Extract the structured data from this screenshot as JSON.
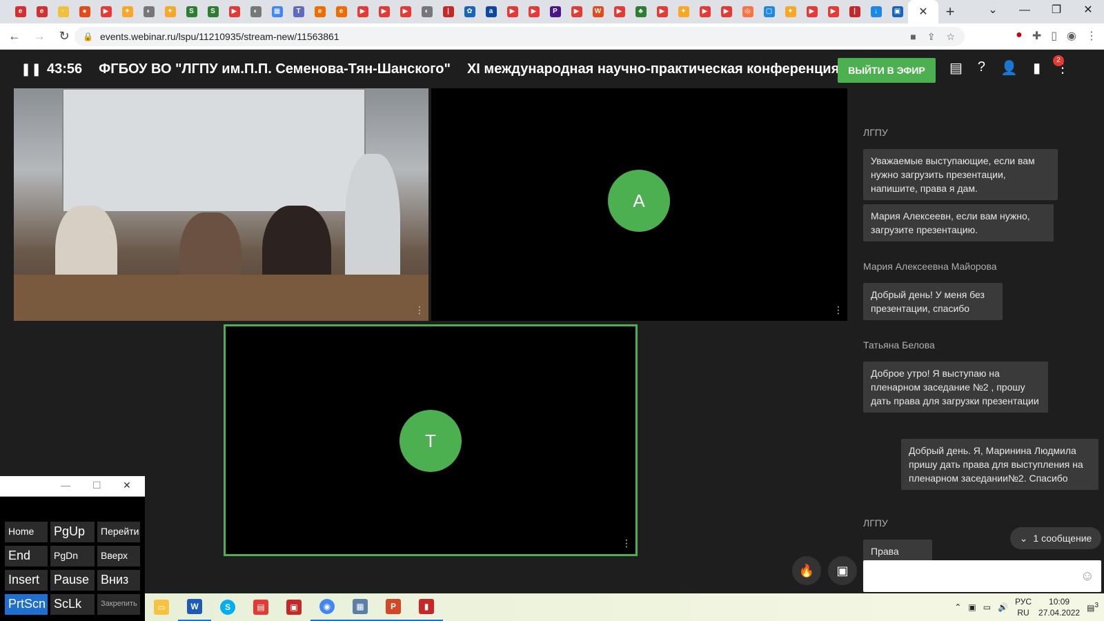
{
  "browser": {
    "url": "events.webinar.ru/lspu/11210935/stream-new/11563861",
    "new_tab": "+",
    "close_tab": "✕",
    "window": {
      "minimize": "—",
      "restore": "❐",
      "close": "✕"
    }
  },
  "app": {
    "timer": "43:56",
    "org_title": "ФГБОУ ВО \"ЛГПУ им.П.П. Семенова-Тян-Шанского\"",
    "conf_title": "XI международная научно-практическая конференция",
    "on_air_label": "ВЫЙТИ В ЭФИР",
    "docs_badge": "2"
  },
  "stage": {
    "tile2_initial": "А",
    "tile3_initial": "Т"
  },
  "chat": {
    "messages": [
      {
        "sender": "ЛГПУ"
      },
      {
        "text": "Уважаемые выступающие, если вам нужно загрузить презентации, напишите, права я дам."
      },
      {
        "text": "Мария Алексеевн, если вам нужно, загрузите презентацию."
      },
      {
        "sender": "Мария Алексеевна Майорова"
      },
      {
        "text": "Добрый день! У меня без презентации, спасибо"
      },
      {
        "sender": "Татьяна Белова"
      },
      {
        "text": "Доброе утро! Я выступаю на пленарном заседание №2 , прошу дать права для загрузки презентации"
      },
      {
        "text": "Добрый день. Я, Маринина Людмила пришу дать права для выступления на пленарном заседании№2. Спасибо"
      },
      {
        "sender": "ЛГПУ"
      },
      {
        "text": "Права выданы."
      }
    ],
    "new_messages": "1 сообщение"
  },
  "osk": {
    "keys": [
      "Home",
      "PgUp",
      "Перейти",
      "End",
      "PgDn",
      "Вверх",
      "Insert",
      "Pause",
      "Вниз",
      "PrtScn",
      "ScLk",
      "Закрепить"
    ]
  },
  "taskbar": {
    "lang_top": "РУС",
    "lang_bottom": "RU",
    "time": "10:09",
    "date": "27.04.2022",
    "notif_count": "3"
  }
}
